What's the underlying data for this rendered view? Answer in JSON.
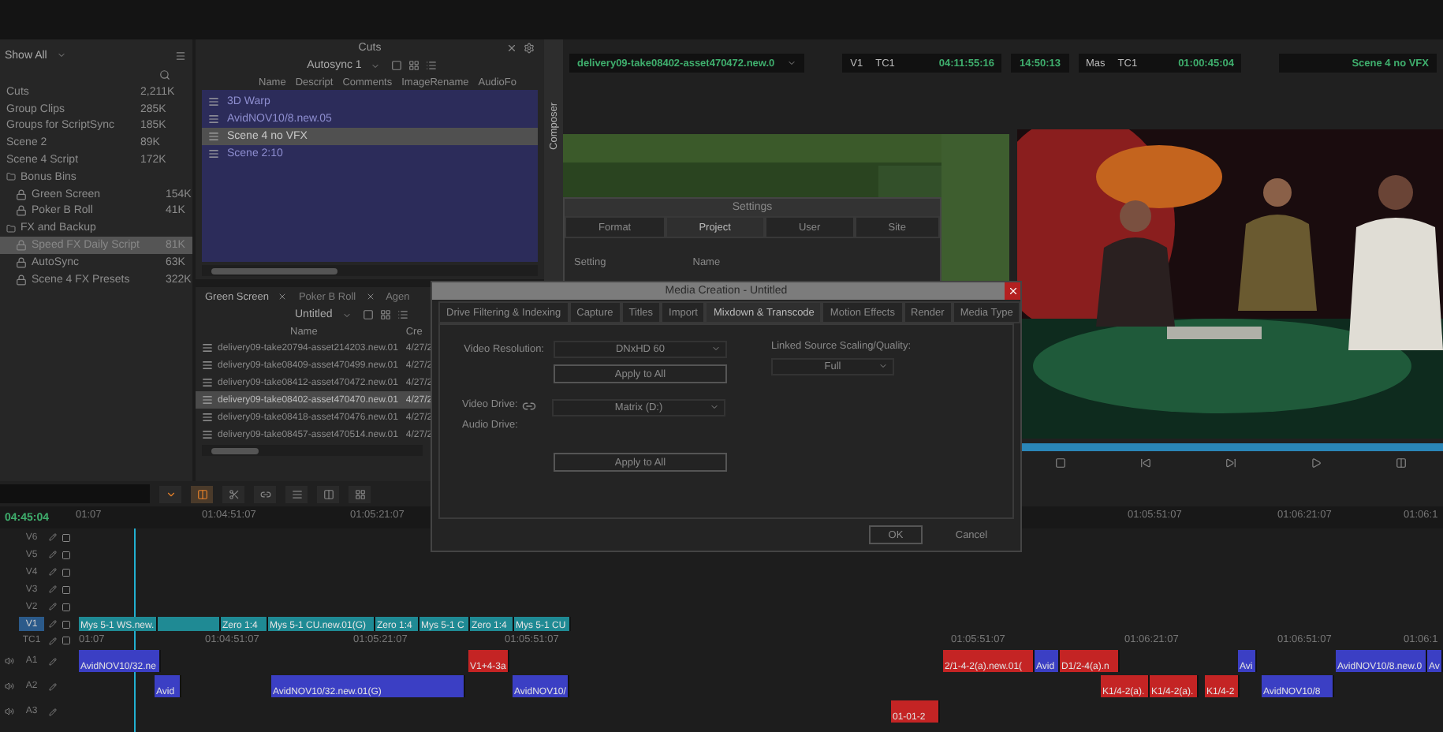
{
  "project": {
    "view": "Show All",
    "bins": [
      {
        "name": "Cuts",
        "size": "2,211K",
        "kind": "bin",
        "selected": false
      },
      {
        "name": "Group Clips",
        "size": "285K",
        "kind": "bin",
        "selected": false
      },
      {
        "name": "Groups for ScriptSync",
        "size": "185K",
        "kind": "bin",
        "selected": false
      },
      {
        "name": "Scene 2",
        "size": "89K",
        "kind": "bin",
        "selected": false
      },
      {
        "name": "Scene 4 Script",
        "size": "172K",
        "kind": "bin",
        "selected": false
      },
      {
        "name": "Bonus Bins",
        "kind": "folder",
        "selected": false,
        "children": [
          {
            "name": "Green Screen",
            "size": "154K",
            "kind": "bin",
            "selected": false
          },
          {
            "name": "Poker B Roll",
            "size": "41K",
            "kind": "bin",
            "selected": false
          }
        ]
      },
      {
        "name": "FX and Backup",
        "kind": "folder",
        "selected": false,
        "children": [
          {
            "name": "Speed FX Daily Script",
            "size": "81K",
            "kind": "bin",
            "selected": true
          },
          {
            "name": "AutoSync",
            "size": "63K",
            "kind": "bin",
            "selected": false
          },
          {
            "name": "Scene 4 FX Presets",
            "size": "322K",
            "kind": "bin",
            "selected": false
          }
        ]
      }
    ]
  },
  "cuts_bin": {
    "title": "Cuts",
    "view": "Autosync 1",
    "columns": [
      "Name",
      "Descript",
      "Comments",
      "ImageRename",
      "AudioFo"
    ],
    "items": [
      {
        "name": "3D Warp",
        "selected": false
      },
      {
        "name": "AvidNOV10/8.new.05",
        "selected": false
      },
      {
        "name": "Scene 4 no VFX",
        "selected": true
      },
      {
        "name": "Scene 2:10",
        "selected": false
      }
    ]
  },
  "clip_bin": {
    "tabs": [
      {
        "label": "Green Screen",
        "selected": true
      },
      {
        "label": "Poker B Roll",
        "selected": false
      },
      {
        "label": "Agen",
        "selected": false
      }
    ],
    "view": "Untitled",
    "columns": [
      "Name",
      "Cre"
    ],
    "rows": [
      {
        "name": "delivery09-take20794-asset214203.new.01",
        "date": "4/27/2",
        "selected": false
      },
      {
        "name": "delivery09-take08409-asset470499.new.01",
        "date": "4/27/2",
        "selected": false
      },
      {
        "name": "delivery09-take08412-asset470472.new.01",
        "date": "4/27/2",
        "selected": false
      },
      {
        "name": "delivery09-take08402-asset470470.new.01",
        "date": "4/27/2",
        "selected": true
      },
      {
        "name": "delivery09-take08418-asset470476.new.01",
        "date": "4/27/2",
        "selected": false
      },
      {
        "name": "delivery09-take08457-asset470514.new.01",
        "date": "4/27/2",
        "selected": false
      }
    ]
  },
  "composer": {
    "side_tab": "Composer",
    "source_clip": "delivery09-take08402-asset470472.new.0",
    "source_track": "V1",
    "source_tc_label": "TC1",
    "source_tc": "04:11:55:16",
    "duration": "14:50:13",
    "record_track": "Mas",
    "record_tc_label": "TC1",
    "record_tc": "01:00:45:04",
    "sequence": "Scene 4 no VFX"
  },
  "settings": {
    "title": "Settings",
    "tabs": [
      {
        "label": "Format",
        "selected": false
      },
      {
        "label": "Project",
        "selected": true
      },
      {
        "label": "User",
        "selected": false
      },
      {
        "label": "Site",
        "selected": false
      }
    ],
    "columns": [
      "Setting",
      "Name"
    ]
  },
  "media_creation": {
    "title": "Media Creation - Untitled",
    "tabs": [
      {
        "label": "Drive Filtering & Indexing",
        "selected": false
      },
      {
        "label": "Capture",
        "selected": false
      },
      {
        "label": "Titles",
        "selected": false
      },
      {
        "label": "Import",
        "selected": false
      },
      {
        "label": "Mixdown & Transcode",
        "selected": true
      },
      {
        "label": "Motion Effects",
        "selected": false
      },
      {
        "label": "Render",
        "selected": false
      },
      {
        "label": "Media Type",
        "selected": false
      }
    ],
    "video_resolution_label": "Video Resolution:",
    "video_resolution": "DNxHD 60",
    "apply_all_resolution": "Apply to All",
    "video_drive_label": "Video Drive:",
    "audio_drive_label": "Audio Drive:",
    "drive": "Matrix (D:)",
    "apply_all_drive": "Apply to All",
    "scaling_label": "Linked Source Scaling/Quality:",
    "scaling": "Full",
    "buttons": [
      "OK",
      "Cancel"
    ]
  },
  "timeline": {
    "timecode": "04:45:04",
    "ruler": [
      "01:07",
      "01:04:51:07",
      "01:05:21:07",
      "01:05:51:07",
      "01:06:21:07",
      "01:06:1"
    ],
    "tracks": [
      {
        "name": "V6",
        "kind": "video",
        "selected": false
      },
      {
        "name": "V5",
        "kind": "video",
        "selected": false
      },
      {
        "name": "V4",
        "kind": "video",
        "selected": false
      },
      {
        "name": "V3",
        "kind": "video",
        "selected": false
      },
      {
        "name": "V2",
        "kind": "video",
        "selected": false
      },
      {
        "name": "V1",
        "kind": "video",
        "selected": true,
        "clips": [
          {
            "label": "Mys 5-1 WS.new.",
            "color": "#1f8a94"
          },
          {
            "color": "#1f8a94"
          },
          {
            "label": "Zero 1:4",
            "color": "#1f8a94"
          },
          {
            "label": "Mys 5-1 CU.new.01(G)",
            "color": "#1f8a94"
          },
          {
            "label": "Zero 1:4",
            "color": "#1f8a94"
          },
          {
            "label": "Mys 5-1 C",
            "color": "#1f8a94"
          },
          {
            "label": "Zero 1:4",
            "color": "#1f8a94"
          },
          {
            "label": "Mys 5-1 CU",
            "color": "#1f8a94"
          }
        ]
      },
      {
        "name": "TC1",
        "kind": "timecode",
        "selected": false,
        "labels": [
          "01:07",
          "01:04:51:07",
          "01:05:21:07",
          "01:05:51:07",
          "01:05:51:07",
          "01:06:21:07",
          "01:06:51:07",
          "01:06:1"
        ]
      },
      {
        "name": "A1",
        "kind": "audio",
        "selected": false,
        "clips": [
          {
            "label": "AvidNOV10/32.ne",
            "color": "#3b3fc4"
          },
          {
            "label": "V1+4-3a",
            "color": "#c42424"
          },
          {
            "label": "2/1-4-2(a).new.01(",
            "color": "#c42424"
          },
          {
            "label": "Avid",
            "color": "#3b3fc4"
          },
          {
            "label": "D1/2-4(a).n",
            "color": "#c42424"
          },
          {
            "label": "Avi",
            "color": "#3b3fc4"
          },
          {
            "label": "AvidNOV10/8.new.0",
            "color": "#3b3fc4"
          },
          {
            "label": "Av",
            "color": "#3b3fc4"
          }
        ]
      },
      {
        "name": "A2",
        "kind": "audio",
        "selected": false,
        "clips": [
          {
            "label": "Avid",
            "color": "#3b3fc4"
          },
          {
            "label": "AvidNOV10/32.new.01(G)",
            "color": "#3b3fc4"
          },
          {
            "label": "AvidNOV10/",
            "color": "#3b3fc4"
          },
          {
            "label": "K1/4-2(a).",
            "color": "#c42424"
          },
          {
            "label": "K1/4-2(a).",
            "color": "#c42424"
          },
          {
            "label": "K1/4-2",
            "color": "#c42424"
          },
          {
            "label": "AvidNOV10/8",
            "color": "#3b3fc4"
          }
        ]
      },
      {
        "name": "A3",
        "kind": "audio",
        "selected": false,
        "clips": [
          {
            "label": "01-01-2",
            "color": "#c42424"
          }
        ]
      }
    ]
  }
}
